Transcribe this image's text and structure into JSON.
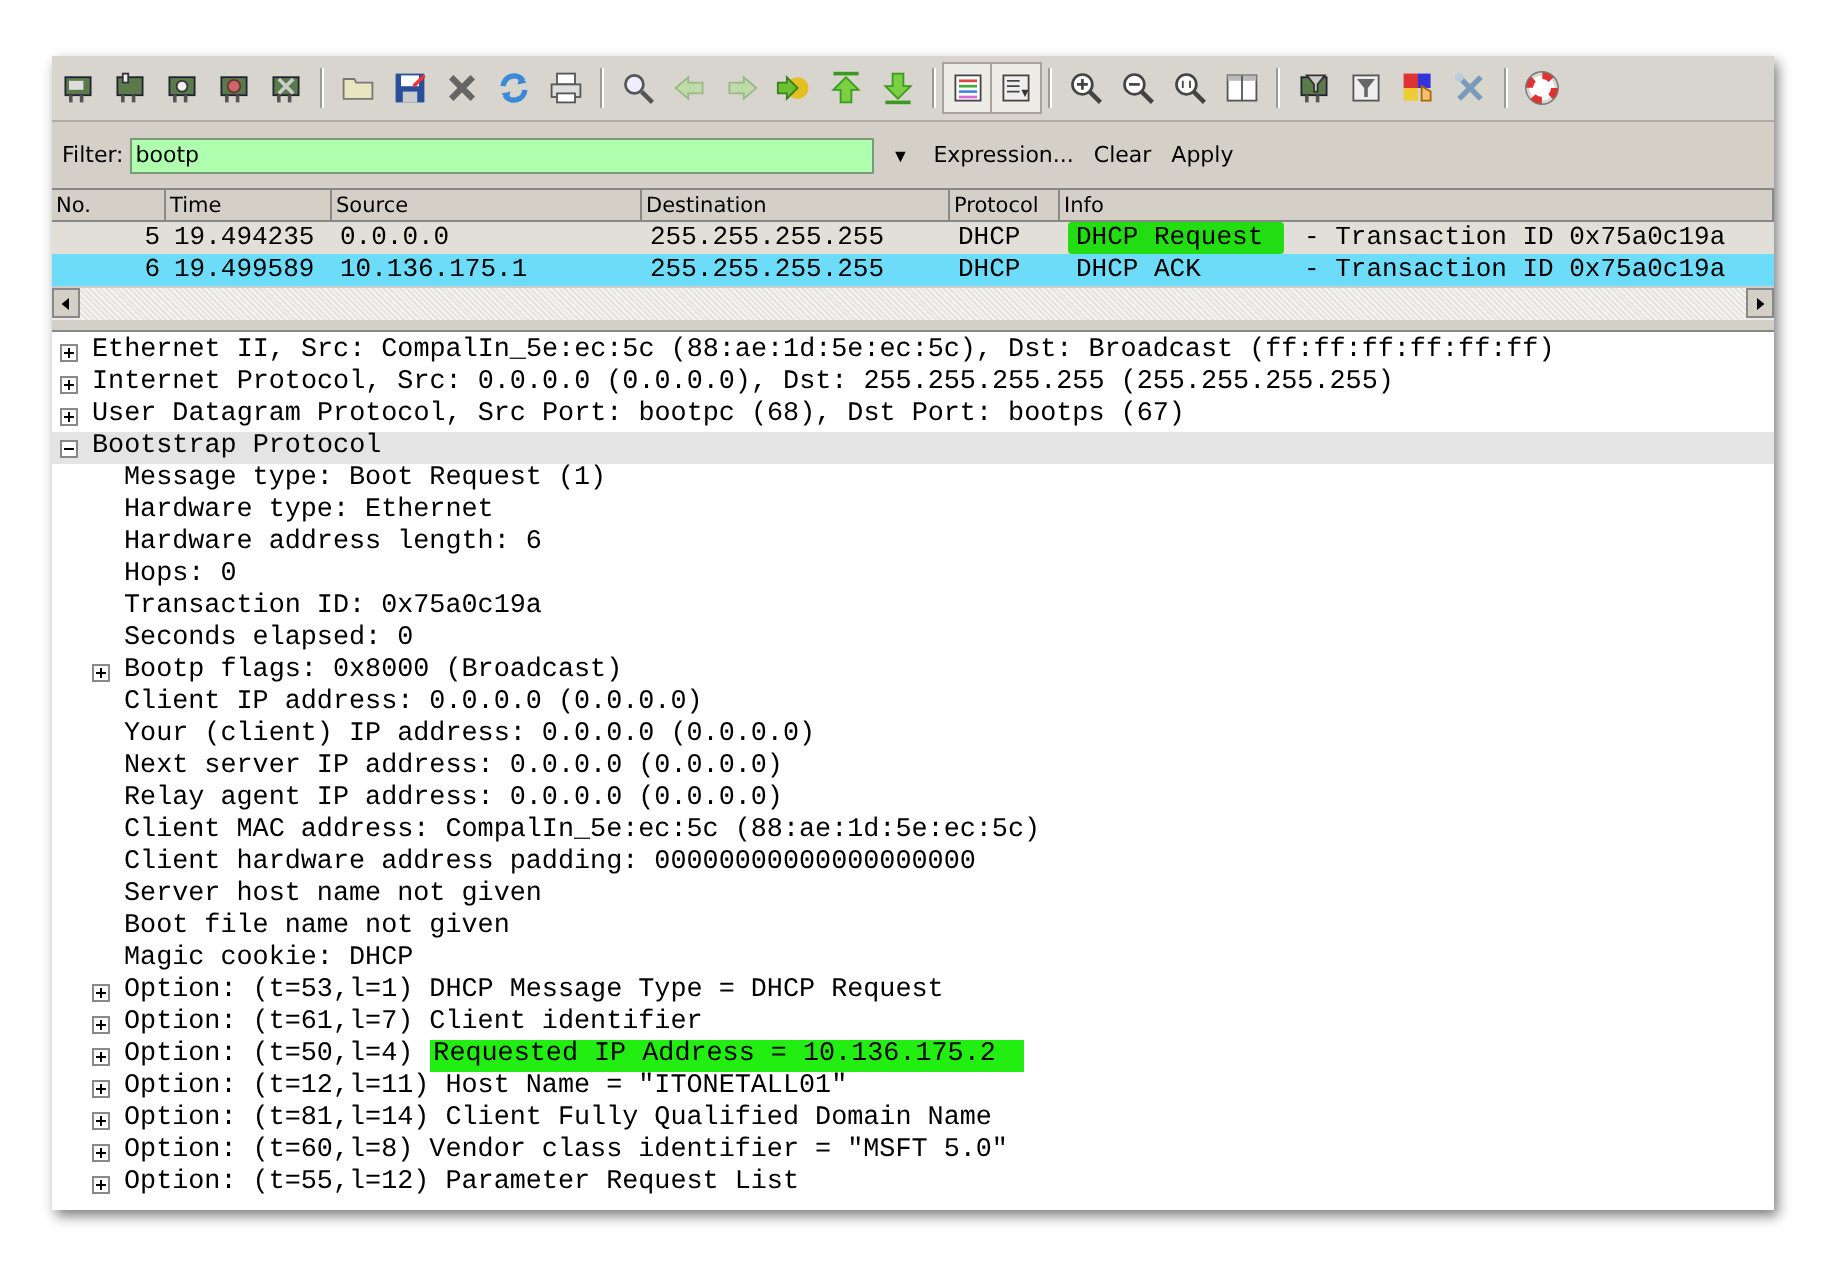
{
  "toolbar_toggles": [
    {
      "pressed": true
    },
    {
      "pressed": true
    }
  ],
  "filter": {
    "label": "Filter:",
    "value": "bootp",
    "dropdown": "▼",
    "buttons": [
      "Expression...",
      "Clear",
      "Apply"
    ]
  },
  "packet_list": {
    "columns": [
      "No.",
      "Time",
      "Source",
      "Destination",
      "Protocol",
      "Info"
    ],
    "rows": [
      {
        "no": "5",
        "time": "19.494235",
        "source": "0.0.0.0",
        "destination": "255.255.255.255",
        "protocol": "DHCP",
        "info_marked": "DHCP Request",
        "info": "- Transaction ID 0x75a0c19a",
        "marked": true,
        "selected": false
      },
      {
        "no": "6",
        "time": "19.499589",
        "source": "10.136.175.1",
        "destination": "255.255.255.255",
        "protocol": "DHCP",
        "info_marked": "DHCP ACK",
        "info": "- Transaction ID 0x75a0c19a",
        "marked": false,
        "selected": true
      }
    ]
  },
  "details": [
    {
      "kind": "group",
      "text": "Ethernet II, Src: CompalIn_5e:ec:5c (88:ae:1d:5e:ec:5c), Dst: Broadcast (ff:ff:ff:ff:ff:ff)",
      "expanded": false,
      "selected": false
    },
    {
      "kind": "group",
      "text": "Internet Protocol, Src: 0.0.0.0 (0.0.0.0), Dst: 255.255.255.255 (255.255.255.255)",
      "expanded": false,
      "selected": false
    },
    {
      "kind": "group",
      "text": "User Datagram Protocol, Src Port: bootpc (68), Dst Port: bootps (67)",
      "expanded": false,
      "selected": false
    },
    {
      "kind": "group",
      "text": "Bootstrap Protocol",
      "expanded": true,
      "selected": true,
      "children": [
        {
          "kind": "field",
          "text": "Message type: Boot Request (1)",
          "selected": false
        },
        {
          "kind": "field",
          "text": "Hardware type: Ethernet",
          "selected": false
        },
        {
          "kind": "field",
          "text": "Hardware address length: 6",
          "selected": false
        },
        {
          "kind": "field",
          "text": "Hops: 0",
          "selected": false
        },
        {
          "kind": "field",
          "text": "Transaction ID: 0x75a0c19a",
          "selected": false
        },
        {
          "kind": "field",
          "text": "Seconds elapsed: 0",
          "selected": false
        },
        {
          "kind": "group",
          "text": "Bootp flags: 0x8000 (Broadcast)",
          "expanded": false,
          "selected": false
        },
        {
          "kind": "field",
          "text": "Client IP address: 0.0.0.0 (0.0.0.0)",
          "selected": false
        },
        {
          "kind": "field",
          "text": "Your (client) IP address: 0.0.0.0 (0.0.0.0)",
          "selected": false
        },
        {
          "kind": "field",
          "text": "Next server IP address: 0.0.0.0 (0.0.0.0)",
          "selected": false
        },
        {
          "kind": "field",
          "text": "Relay agent IP address: 0.0.0.0 (0.0.0.0)",
          "selected": false
        },
        {
          "kind": "field",
          "text": "Client MAC address: CompalIn_5e:ec:5c (88:ae:1d:5e:ec:5c)",
          "selected": false
        },
        {
          "kind": "field",
          "text": "Client hardware address padding: 00000000000000000000",
          "selected": false
        },
        {
          "kind": "field",
          "text": "Server host name not given",
          "selected": false
        },
        {
          "kind": "field",
          "text": "Boot file name not given",
          "selected": false
        },
        {
          "kind": "field",
          "text": "Magic cookie: DHCP",
          "selected": false
        },
        {
          "kind": "group",
          "text": "Option: (t=53,l=1) DHCP Message Type = DHCP Request",
          "expanded": false,
          "selected": false
        },
        {
          "kind": "group",
          "text": "Option: (t=61,l=7) Client identifier",
          "expanded": false,
          "selected": false
        },
        {
          "kind": "group",
          "text": "Option: (t=50,l=4)",
          "marked_text": "Requested IP Address = 10.136.175.2",
          "expanded": false,
          "selected": false
        },
        {
          "kind": "group",
          "text": "Option: (t=12,l=11) Host Name = \"ITONETALL01\"",
          "expanded": false,
          "selected": false
        },
        {
          "kind": "group",
          "text": "Option: (t=81,l=14) Client Fully Qualified Domain Name",
          "expanded": false,
          "selected": false
        },
        {
          "kind": "group",
          "text": "Option: (t=60,l=8) Vendor class identifier = \"MSFT 5.0\"",
          "expanded": false,
          "selected": false
        },
        {
          "kind": "group",
          "text": "Option: (t=55,l=12) Parameter Request List",
          "expanded": false,
          "selected": false
        }
      ]
    }
  ]
}
